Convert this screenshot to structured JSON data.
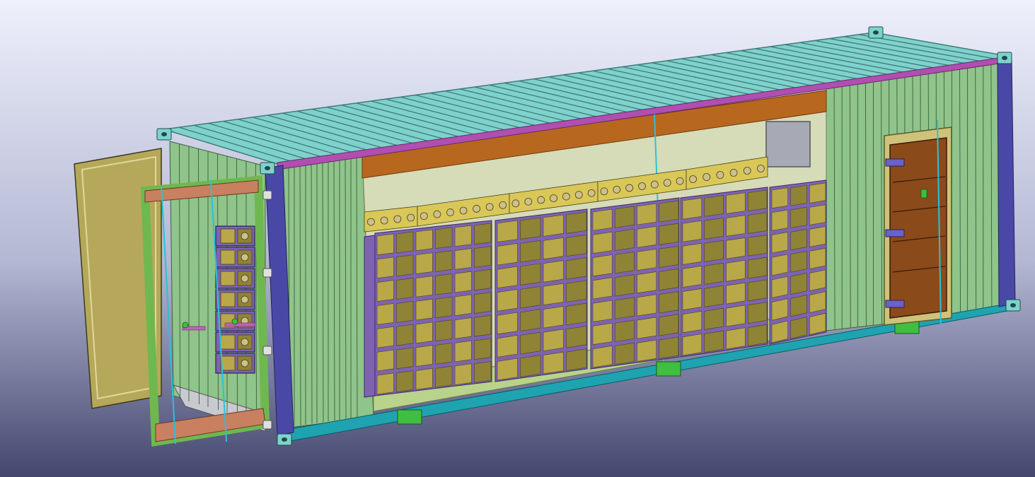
{
  "viewport": {
    "background_top": "#eef0fb",
    "background_mid": "#b3b7d3",
    "background_bottom": "#44476e"
  },
  "container": {
    "roof_color": "#7fd2cc",
    "roof_ridge_color": "#3f7a7a",
    "wall_color": "#8fc48a",
    "wall_line_color": "#3d5f3a",
    "top_rail_color": "#b04fb0",
    "bottom_rail_color": "#1fa3b0",
    "corner_post_color": "#4a48a6",
    "corner_casting_color": "#7fd2cc",
    "forklift_pocket_color": "#3fbf3f",
    "interior_beam_color": "#b8681e",
    "floor_color": "#b9d38c"
  },
  "battery_rack": {
    "cabinet_color": "#7d63b0",
    "cell_color": "#b9a848",
    "cell_face_color": "#8f8436",
    "module_top_color": "#d9c858",
    "columns": 5,
    "rows": 7
  },
  "service_door": {
    "door_color": "#8a4a1a",
    "frame_color": "#cfc27a",
    "hinge_color": "#6a62c8"
  },
  "end_doors": {
    "open_door_color": "#b6a85a",
    "open_door_frame_color": "#e0d89a",
    "swing_frame_color": "#6fb84f",
    "lock_bar_color": "#29c2d8",
    "lower_frame_color": "#c98060"
  },
  "electrical_box": {
    "color": "#a7a9b4"
  }
}
